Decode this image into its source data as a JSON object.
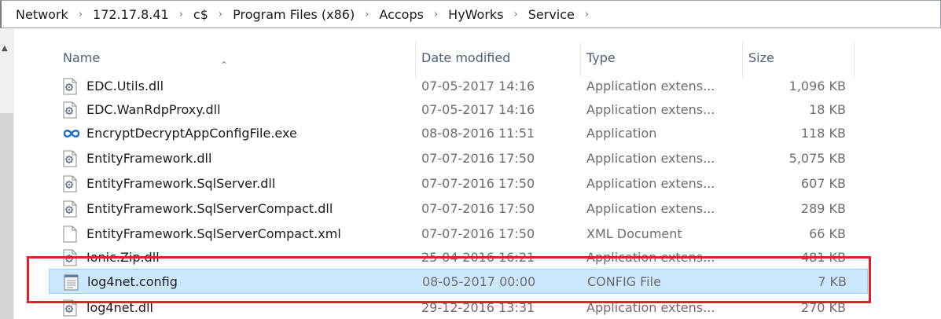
{
  "breadcrumb": [
    {
      "label": "Network"
    },
    {
      "label": "172.17.8.41"
    },
    {
      "label": "c$"
    },
    {
      "label": "Program Files (x86)"
    },
    {
      "label": "Accops"
    },
    {
      "label": "HyWorks"
    },
    {
      "label": "Service"
    }
  ],
  "columns": {
    "name": "Name",
    "date": "Date modified",
    "type": "Type",
    "size": "Size"
  },
  "files": [
    {
      "name": "EDC.Utils.dll",
      "date": "07-05-2017 14:16",
      "type": "Application extens...",
      "size": "1,096 KB",
      "icon": "dll-gear-icon"
    },
    {
      "name": "EDC.WanRdpProxy.dll",
      "date": "07-05-2017 14:16",
      "type": "Application extens...",
      "size": "18 KB",
      "icon": "dll-gear-icon"
    },
    {
      "name": "EncryptDecryptAppConfigFile.exe",
      "date": "08-08-2016 11:51",
      "type": "Application",
      "size": "118 KB",
      "icon": "infinity-app-icon"
    },
    {
      "name": "EntityFramework.dll",
      "date": "07-07-2016 17:50",
      "type": "Application extens...",
      "size": "5,075 KB",
      "icon": "dll-gear-icon"
    },
    {
      "name": "EntityFramework.SqlServer.dll",
      "date": "07-07-2016 17:50",
      "type": "Application extens...",
      "size": "607 KB",
      "icon": "dll-gear-icon"
    },
    {
      "name": "EntityFramework.SqlServerCompact.dll",
      "date": "07-07-2016 17:50",
      "type": "Application extens...",
      "size": "289 KB",
      "icon": "dll-gear-icon"
    },
    {
      "name": "EntityFramework.SqlServerCompact.xml",
      "date": "07-07-2016 17:50",
      "type": "XML Document",
      "size": "66 KB",
      "icon": "blank-file-icon"
    },
    {
      "name": "Ionic.Zip.dll",
      "date": "25-04-2016 16:21",
      "type": "Application extens...",
      "size": "481 KB",
      "icon": "dll-gear-icon"
    },
    {
      "name": "log4net.config",
      "date": "08-05-2017 00:00",
      "type": "CONFIG File",
      "size": "7 KB",
      "icon": "config-file-icon",
      "selected": true
    },
    {
      "name": "log4net.dll",
      "date": "29-12-2016 13:31",
      "type": "Application extens...",
      "size": "270 KB",
      "icon": "dll-gear-icon"
    }
  ],
  "colors": {
    "selection_bg": "#cce8ff",
    "selection_border": "#99d1ff",
    "highlight_box": "#e0202a",
    "header_text": "#4c607a"
  }
}
